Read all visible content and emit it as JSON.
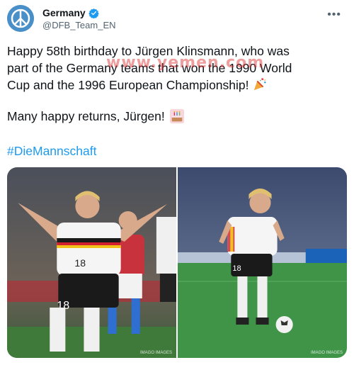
{
  "account": {
    "display_name": "Germany",
    "handle": "@DFB_Team_EN",
    "avatar_icon": "peace-symbol-icon",
    "verified_icon": "verified-badge-icon"
  },
  "tweet": {
    "line1": "Happy 58th birthday to Jürgen Klinsmann, who was",
    "line2": "part of the Germany teams that won the 1990 World",
    "line3": "Cup and the 1996 European Championship!",
    "line3_emoji": "party-popper-icon",
    "para2": "Many happy returns, Jürgen!",
    "para2_emoji": "birthday-cake-icon",
    "hashtag": "#DieMannschaft"
  },
  "watermark": "www.yemen.com",
  "media": {
    "photo1_credit": "IMAGO IMAGES",
    "photo2_credit": "IMAGO IMAGES"
  },
  "colors": {
    "link": "#1d9bf0",
    "text": "#0f1419",
    "secondary": "#536471",
    "avatar_bg": "#4a90c8"
  }
}
